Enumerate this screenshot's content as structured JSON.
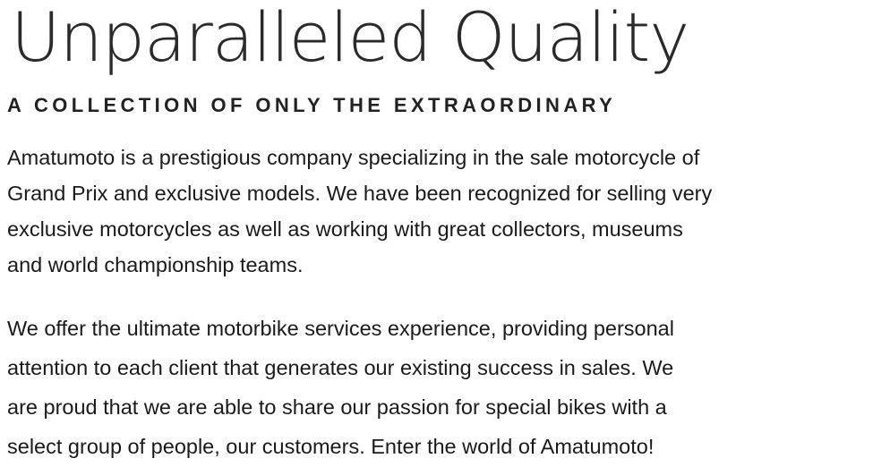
{
  "headline": "Unparalleled Quality",
  "subheadline": "A COLLECTION OF ONLY THE EXTRAORDINARY",
  "paragraphs": [
    {
      "lines": [
        "Amatumoto is a prestigious company specializing in the sale motorcycle of",
        "Grand Prix and exclusive models. We have been recognized for selling very",
        "exclusive motorcycles as well as working with great collectors, museums",
        "and world championship teams."
      ]
    },
    {
      "lines": [
        "We offer the ultimate motorbike services experience, providing personal",
        "attention to each client that generates our existing success in sales. We",
        "are proud that we are able to share our passion for special bikes with a",
        "select group of people, our customers. Enter the world of Amatumoto!"
      ]
    }
  ]
}
